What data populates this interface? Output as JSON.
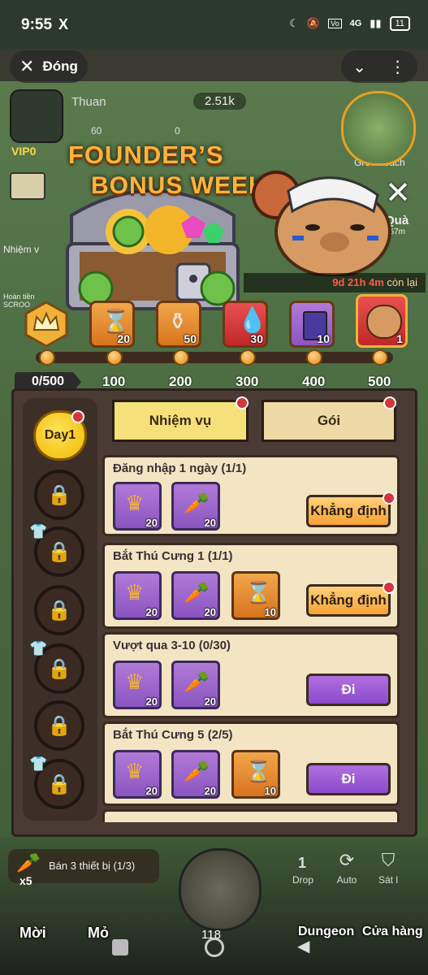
{
  "status_bar": {
    "time": "9:55",
    "app_icon": "X",
    "battery": "11",
    "network": "4G"
  },
  "top_bar": {
    "close_label": "Đóng"
  },
  "background_hud": {
    "player_name": "Thuan",
    "power": "2.51k",
    "gems": "60",
    "crystals": "0",
    "vip": "VIP0",
    "side_left": [
      "Nhiệm v",
      "Hoàn tiền SCROO"
    ],
    "side_right": [
      "Greenteach",
      "Quà",
      "23h 57m"
    ]
  },
  "event": {
    "title_line1": "FOUNDER’S",
    "title_line2": "BONUS WEEK",
    "timer_highlight": "9d 21h 4m",
    "timer_suffix": " còn lại"
  },
  "track": {
    "progress": "0/500",
    "milestones": [
      "100",
      "200",
      "300",
      "400",
      "500"
    ],
    "rewards": [
      {
        "icon": "hourglass-icon",
        "count": "20"
      },
      {
        "icon": "vase-icon",
        "count": "50"
      },
      {
        "icon": "blood-drop-icon",
        "count": "30"
      },
      {
        "icon": "card-icon",
        "count": "10"
      },
      {
        "icon": "capybara-icon",
        "count": "1"
      }
    ]
  },
  "days": {
    "current": "Day1"
  },
  "tabs": {
    "tasks": "Nhiệm vụ",
    "packs": "Gói"
  },
  "tasks": [
    {
      "title": "Đăng nhập 1 ngày (1/1)",
      "rewards": [
        {
          "icon": "crown-badge-icon",
          "count": "20"
        },
        {
          "icon": "carrot-icon",
          "count": "20"
        }
      ],
      "button": "Khẳng định",
      "button_type": "confirm"
    },
    {
      "title": "Bắt Thú Cưng 1 (1/1)",
      "rewards": [
        {
          "icon": "crown-badge-icon",
          "count": "20"
        },
        {
          "icon": "carrot-icon",
          "count": "20"
        },
        {
          "icon": "hourglass-icon",
          "count": "10"
        }
      ],
      "button": "Khẳng định",
      "button_type": "confirm"
    },
    {
      "title": "Vượt qua 3-10 (0/30)",
      "rewards": [
        {
          "icon": "crown-badge-icon",
          "count": "20"
        },
        {
          "icon": "carrot-icon",
          "count": "20"
        }
      ],
      "button": "Đi",
      "button_type": "go"
    },
    {
      "title": "Bắt Thú Cưng 5 (2/5)",
      "rewards": [
        {
          "icon": "crown-badge-icon",
          "count": "20"
        },
        {
          "icon": "carrot-icon",
          "count": "20"
        },
        {
          "icon": "hourglass-icon",
          "count": "10"
        }
      ],
      "button": "Đi",
      "button_type": "go"
    }
  ],
  "bottom": {
    "quest": "Bán 3 thiết bị (1/3)",
    "quest_count": "x5",
    "buttons": [
      "Drop",
      "Auto",
      "Sát l"
    ],
    "drop_count": "1",
    "nav": [
      "Mời",
      "Mỏ",
      "Dungeon",
      "Cửa hàng"
    ],
    "level": "118"
  }
}
